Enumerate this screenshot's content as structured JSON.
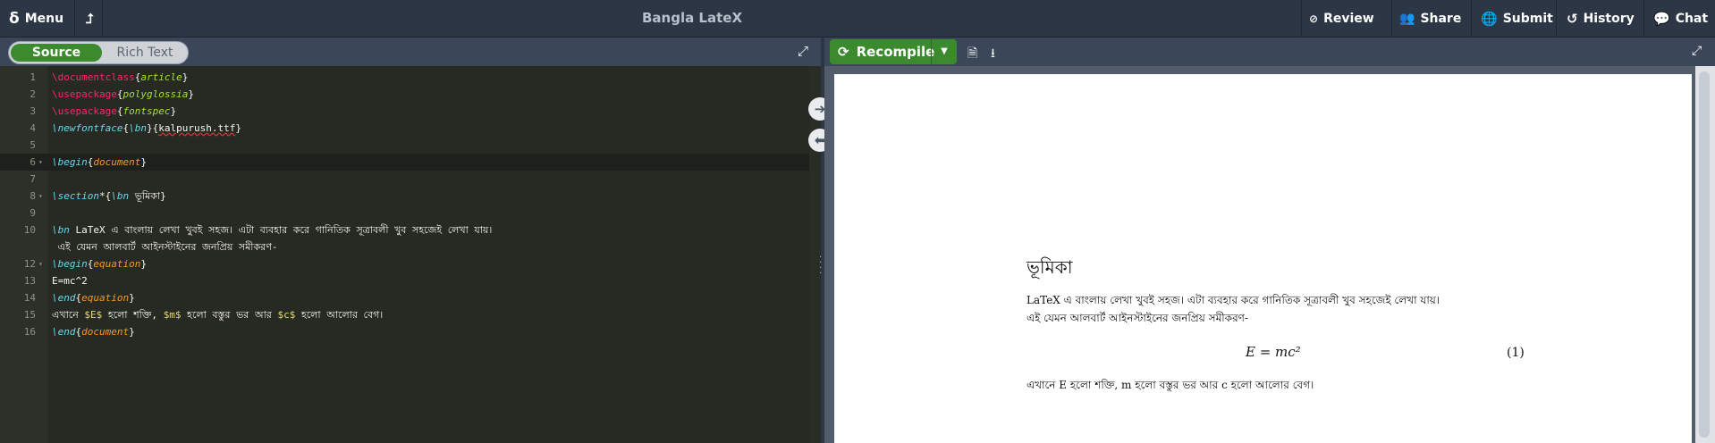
{
  "topbar": {
    "menu_label": "Menu",
    "title": "Bangla LateX",
    "review_label": "Review",
    "share_label": "Share",
    "submit_label": "Submit",
    "history_label": "History",
    "chat_label": "Chat"
  },
  "editor_toolbar": {
    "source_label": "Source",
    "rich_text_label": "Rich Text"
  },
  "preview_toolbar": {
    "recompile_label": "Recompile"
  },
  "editor": {
    "lines": [
      {
        "n": "1",
        "parts": [
          [
            "kw",
            "\\documentclass"
          ],
          [
            "",
            "{"
          ],
          [
            "arg",
            "article"
          ],
          [
            "",
            "}"
          ]
        ]
      },
      {
        "n": "2",
        "parts": [
          [
            "kw",
            "\\usepackage"
          ],
          [
            "",
            "{"
          ],
          [
            "arg",
            "polyglossia"
          ],
          [
            "",
            "}"
          ]
        ]
      },
      {
        "n": "3",
        "parts": [
          [
            "kw",
            "\\usepackage"
          ],
          [
            "",
            "{"
          ],
          [
            "arg",
            "fontspec"
          ],
          [
            "",
            "}"
          ]
        ]
      },
      {
        "n": "4",
        "parts": [
          [
            "cmd",
            "\\newfontface"
          ],
          [
            "",
            "{"
          ],
          [
            "cmd",
            "\\bn"
          ],
          [
            "",
            "}{"
          ],
          [
            "squig",
            "kalpurush.ttf"
          ],
          [
            "",
            "}"
          ]
        ]
      },
      {
        "n": "5",
        "parts": []
      },
      {
        "n": "6",
        "fold": true,
        "parts": [
          [
            "cmd",
            "\\begin"
          ],
          [
            "",
            "{"
          ],
          [
            "env",
            "document"
          ],
          [
            "",
            "}"
          ]
        ]
      },
      {
        "n": "7",
        "parts": []
      },
      {
        "n": "8",
        "fold": true,
        "parts": [
          [
            "cmd",
            "\\section"
          ],
          [
            "",
            "*{"
          ],
          [
            "cmd",
            "\\bn"
          ],
          [
            "",
            " ভূমিকা}"
          ]
        ]
      },
      {
        "n": "9",
        "parts": []
      },
      {
        "n": "10",
        "parts": [
          [
            "cmd",
            "\\bn"
          ],
          [
            "",
            " LaTeX এ বাংলায় লেখা খুবই সহজ। এটা ব্যবহার করে গানিতিক সূত্রাবলী খুব সহজেই লেখা যায়।"
          ]
        ]
      },
      {
        "n": "",
        "parts": [
          [
            "",
            " এই যেমন আলবার্ট আইনস্টাইনের জনপ্রিয় সমীকরণ-"
          ]
        ]
      },
      {
        "n": "12",
        "fold": true,
        "parts": [
          [
            "cmd",
            "\\begin"
          ],
          [
            "",
            "{"
          ],
          [
            "env",
            "equation"
          ],
          [
            "",
            "}"
          ]
        ]
      },
      {
        "n": "13",
        "parts": [
          [
            "",
            "E=mc^2"
          ]
        ]
      },
      {
        "n": "14",
        "parts": [
          [
            "cmd",
            "\\end"
          ],
          [
            "",
            "{"
          ],
          [
            "env",
            "equation"
          ],
          [
            "",
            "}"
          ]
        ]
      },
      {
        "n": "15",
        "parts": [
          [
            "",
            "এখানে "
          ],
          [
            "math",
            "$E$"
          ],
          [
            "",
            " হলো শক্তি, "
          ],
          [
            "math",
            "$m$"
          ],
          [
            "",
            " হলো বস্তুর ভর আর "
          ],
          [
            "math",
            "$c$"
          ],
          [
            "",
            " হলো আলোর বেগ।"
          ]
        ]
      },
      {
        "n": "16",
        "parts": [
          [
            "cmd",
            "\\end"
          ],
          [
            "",
            "{"
          ],
          [
            "env",
            "document"
          ],
          [
            "",
            "}"
          ]
        ]
      }
    ]
  },
  "preview": {
    "heading": "ভূমিকা",
    "para1": "LaTeX এ বাংলায় লেখা খুবই সহজ। এটা ব্যবহার করে গানিতিক সূত্রাবলী খুব সহজেই লেখা যায়।",
    "para2": "এই যেমন আলবার্ট আইনস্টাইনের জনপ্রিয় সমীকরণ-",
    "equation": "E = mc²",
    "equation_number": "(1)",
    "para3": "এখানে E হলো শক্তি, m হলো বস্তুর ভর আর c হলো আলোর বেগ।"
  }
}
